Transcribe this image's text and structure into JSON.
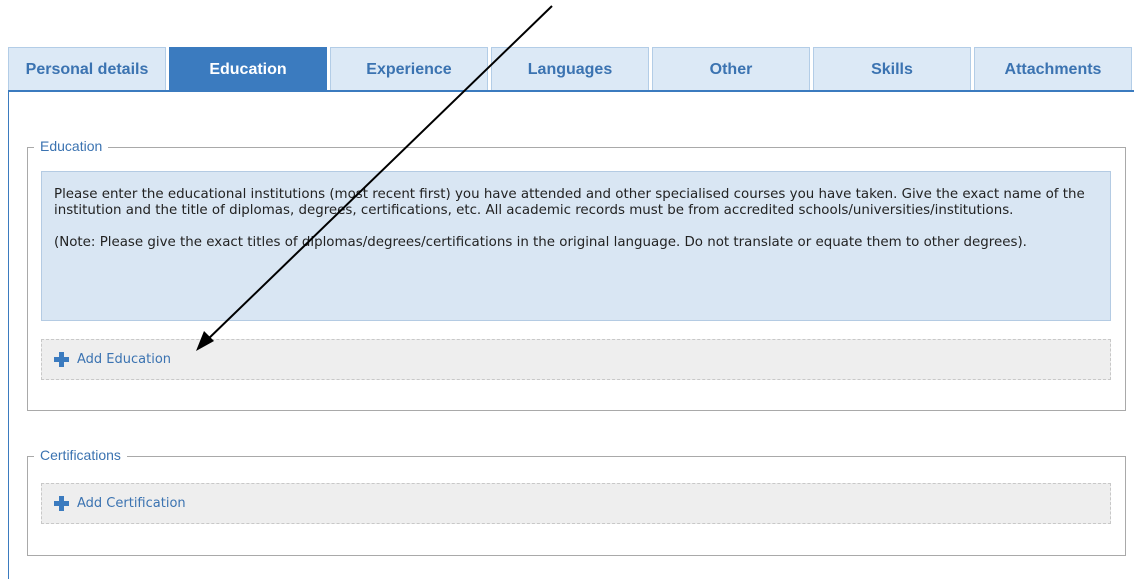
{
  "tabs": [
    {
      "label": "Personal details",
      "active": false
    },
    {
      "label": "Education",
      "active": true
    },
    {
      "label": "Experience",
      "active": false
    },
    {
      "label": "Languages",
      "active": false
    },
    {
      "label": "Other",
      "active": false
    },
    {
      "label": "Skills",
      "active": false
    },
    {
      "label": "Attachments",
      "active": false
    }
  ],
  "education": {
    "legend": "Education",
    "info_paragraph_1": "Please enter the educational institutions (most recent first) you have attended and other specialised courses you have taken. Give the exact name of the institution and the title of diplomas, degrees, certifications, etc. All academic records must be from accredited schools/universities/institutions.",
    "info_paragraph_2": "(Note: Please give the exact titles of diplomas/degrees/certifications in the original language. Do not translate or equate them to other degrees).",
    "add_label": "Add Education"
  },
  "certifications": {
    "legend": "Certifications",
    "add_label": "Add Certification"
  },
  "colors": {
    "accent": "#3b7bbf",
    "tab_inactive_bg": "#dce9f6",
    "info_bg": "#d9e6f3",
    "add_row_bg": "#eeeeee",
    "annotation_arrow": "#000000"
  },
  "icons": [
    "plus-icon",
    "annotation-arrow"
  ]
}
